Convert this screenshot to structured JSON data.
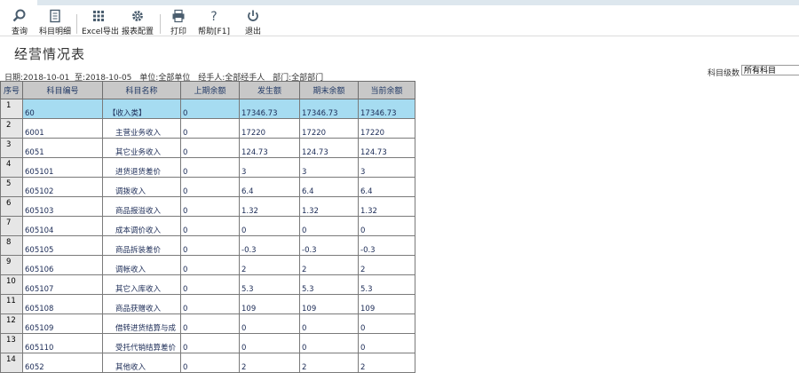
{
  "toolbar": {
    "items": [
      {
        "label": "查询",
        "icon": "search-icon"
      },
      {
        "label": "科目明细",
        "icon": "document-icon"
      },
      {
        "label": "Excel导出",
        "icon": "grid-export-icon"
      },
      {
        "label": "报表配置",
        "icon": "gear-icon"
      },
      {
        "label": "打印",
        "icon": "printer-icon"
      },
      {
        "label": "帮助[F1]",
        "icon": "help-icon"
      },
      {
        "label": "退出",
        "icon": "power-icon"
      }
    ]
  },
  "page": {
    "title": "经营情况表"
  },
  "filter": {
    "date": "日期:2018-10-01  至:2018-10-05",
    "unit": "单位:全部单位",
    "handler": "经手人:全部经手人",
    "department": "部门:全部部门"
  },
  "level": {
    "label": "科目级数",
    "value": "所有科目"
  },
  "table": {
    "headers": [
      "序号",
      "科目编号",
      "科目名称",
      "上期余额",
      "发生额",
      "期末余额",
      "当前余额"
    ],
    "rows": [
      {
        "seq": "1",
        "code": "60",
        "name": "【收入类】",
        "prev": "0",
        "amount": "17346.73",
        "end": "17346.73",
        "current": "17346.73",
        "selected": true,
        "level": 1
      },
      {
        "seq": "2",
        "code": "6001",
        "name": "主营业务收入",
        "prev": "0",
        "amount": "17220",
        "end": "17220",
        "current": "17220",
        "level": 2
      },
      {
        "seq": "3",
        "code": "6051",
        "name": "其它业务收入",
        "prev": "0",
        "amount": "124.73",
        "end": "124.73",
        "current": "124.73",
        "level": 2
      },
      {
        "seq": "4",
        "code": "605101",
        "name": "进货退货差价",
        "prev": "0",
        "amount": "3",
        "end": "3",
        "current": "3",
        "level": 3
      },
      {
        "seq": "5",
        "code": "605102",
        "name": "调拨收入",
        "prev": "0",
        "amount": "6.4",
        "end": "6.4",
        "current": "6.4",
        "level": 3
      },
      {
        "seq": "6",
        "code": "605103",
        "name": "商品报溢收入",
        "prev": "0",
        "amount": "1.32",
        "end": "1.32",
        "current": "1.32",
        "level": 3
      },
      {
        "seq": "7",
        "code": "605104",
        "name": "成本调价收入",
        "prev": "0",
        "amount": "0",
        "end": "0",
        "current": "0",
        "level": 3
      },
      {
        "seq": "8",
        "code": "605105",
        "name": "商品拆装差价",
        "prev": "0",
        "amount": "-0.3",
        "end": "-0.3",
        "current": "-0.3",
        "level": 3
      },
      {
        "seq": "9",
        "code": "605106",
        "name": "调帐收入",
        "prev": "0",
        "amount": "2",
        "end": "2",
        "current": "2",
        "level": 3
      },
      {
        "seq": "10",
        "code": "605107",
        "name": "其它入库收入",
        "prev": "0",
        "amount": "5.3",
        "end": "5.3",
        "current": "5.3",
        "level": 3
      },
      {
        "seq": "11",
        "code": "605108",
        "name": "商品获赠收入",
        "prev": "0",
        "amount": "109",
        "end": "109",
        "current": "109",
        "level": 3
      },
      {
        "seq": "12",
        "code": "605109",
        "name": "借转进货结算与成",
        "prev": "0",
        "amount": "0",
        "end": "0",
        "current": "0",
        "level": 3
      },
      {
        "seq": "13",
        "code": "605110",
        "name": "受托代销结算差价",
        "prev": "0",
        "amount": "0",
        "end": "0",
        "current": "0",
        "level": 3
      },
      {
        "seq": "14",
        "code": "6052",
        "name": "其他收入",
        "prev": "0",
        "amount": "2",
        "end": "2",
        "current": "2",
        "level": 2
      }
    ]
  },
  "colors": {
    "header_bg": "#c8c8c8",
    "selected_row": "#a6dcf1",
    "icon": "#4a5d6e"
  }
}
